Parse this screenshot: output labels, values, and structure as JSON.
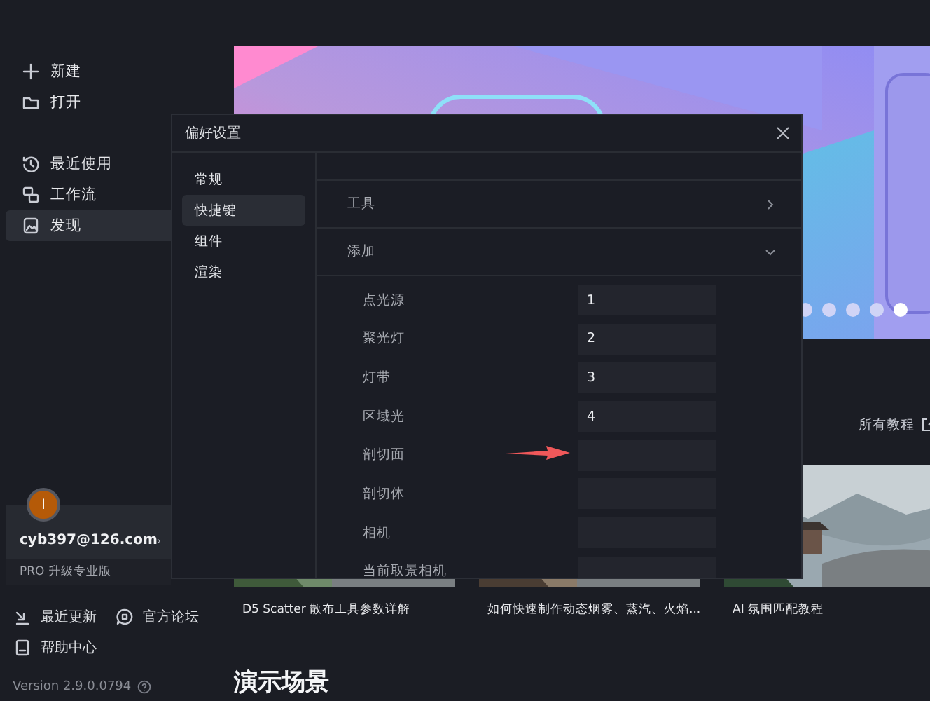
{
  "sidebar": {
    "actions": [
      {
        "label": "新建"
      },
      {
        "label": "打开"
      }
    ],
    "nav": [
      {
        "label": "最近使用",
        "selected": false
      },
      {
        "label": "工作流",
        "selected": false
      },
      {
        "label": "发现",
        "selected": true
      }
    ],
    "account": {
      "avatar_letter": "I",
      "email": "cyb397@126.com",
      "upgrade": "PRO 升级专业版"
    },
    "links": [
      {
        "label": "最近更新"
      },
      {
        "label": "官方论坛"
      },
      {
        "label": "帮助中心"
      }
    ],
    "version": "Version 2.9.0.0794"
  },
  "banner": {
    "kind": "picture",
    "slides": [
      {
        "selected": false
      },
      {
        "selected": false
      },
      {
        "selected": false
      },
      {
        "selected": false
      },
      {
        "selected": true
      }
    ]
  },
  "tutorials": {
    "all_link": "所有教程",
    "items": [
      {
        "title": "D5 Scatter 散布工具参数详解"
      },
      {
        "title": "如何快速制作动态烟雾、蒸汽、火焰..."
      },
      {
        "title": "AI 氛围匹配教程"
      }
    ]
  },
  "section_heading": "演示场景",
  "dialog": {
    "title": "偏好设置",
    "nav": [
      {
        "label": "常规",
        "selected": false
      },
      {
        "label": "快捷键",
        "selected": true
      },
      {
        "label": "组件",
        "selected": false
      },
      {
        "label": "渲染",
        "selected": false
      }
    ],
    "sections": [
      {
        "label": "工具",
        "expanded": false
      },
      {
        "label": "添加",
        "expanded": true,
        "shortcuts": [
          {
            "label": "点光源",
            "value": "1"
          },
          {
            "label": "聚光灯",
            "value": "2"
          },
          {
            "label": "灯带",
            "value": "3"
          },
          {
            "label": "区域光",
            "value": "4"
          },
          {
            "label": "剖切面"
          },
          {
            "label": "剖切体"
          },
          {
            "label": "相机"
          },
          {
            "label": "当前取景相机"
          }
        ]
      }
    ]
  }
}
